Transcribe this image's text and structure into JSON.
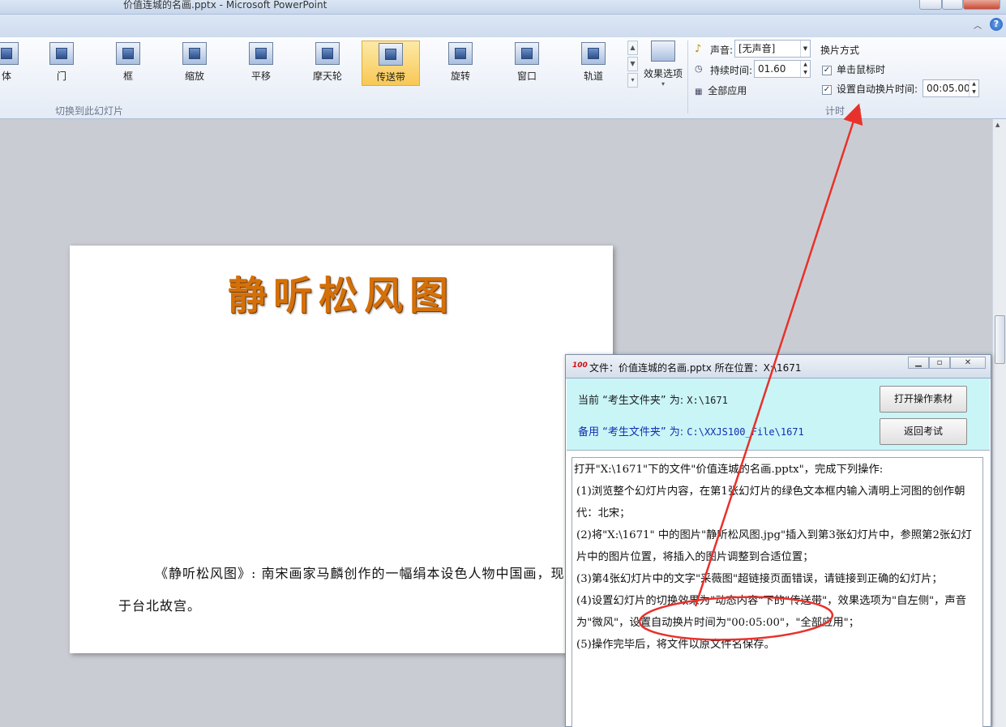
{
  "window": {
    "title": "价值连城的名画.pptx  -  Microsoft PowerPoint"
  },
  "ribbon": {
    "transitions": [
      {
        "label": "体"
      },
      {
        "label": "门"
      },
      {
        "label": "框"
      },
      {
        "label": "缩放"
      },
      {
        "label": "平移"
      },
      {
        "label": "摩天轮"
      },
      {
        "label": "传送带",
        "selected": true
      },
      {
        "label": "旋转"
      },
      {
        "label": "窗口"
      },
      {
        "label": "轨道"
      }
    ],
    "effect_options_label": "效果选项",
    "gallery_group_label": "切换到此幻灯片",
    "sound_label": "声音:",
    "sound_value": "[无声音]",
    "duration_label": "持续时间:",
    "duration_value": "01.60",
    "apply_all_label": "全部应用",
    "advance_title": "换片方式",
    "on_click_label": "单击鼠标时",
    "on_click_checked": true,
    "auto_advance_label": "设置自动换片时间:",
    "auto_advance_checked": true,
    "auto_advance_value": "00:05.00",
    "timing_group_label": "计时"
  },
  "slide": {
    "title": "静听松风图",
    "caption": "《静听松风图》: 南宋画家马麟创作的一幅绢本设色人物中国画，现藏于台北故宫。"
  },
  "dialog": {
    "title": "文件：价值连城的名画.pptx 所在位置：X:\\1671",
    "current_folder_label": "当前 “考生文件夹” 为:",
    "current_folder_value": "X:\\1671",
    "backup_folder_label": "备用 “考生文件夹” 为:",
    "backup_folder_value": "C:\\XXJS100_File\\1671",
    "open_button": "打开操作素材",
    "return_button": "返回考试",
    "instructions": [
      "打开\"X:\\1671\"下的文件\"价值连城的名画.pptx\"，完成下列操作:",
      "(1)浏览整个幻灯片内容，在第1张幻灯片的绿色文本框内输入清明上河图的创作朝代：北宋；",
      "(2)将\"X:\\1671\" 中的图片\"静听松风图.jpg\"插入到第3张幻灯片中，参照第2张幻灯片中的图片位置，将插入的图片调整到合适位置；",
      "(3)第4张幻灯片中的文字\"采薇图\"超链接页面错误，请链接到正确的幻灯片；",
      "(4)设置幻灯片的切换效果为\"动态内容\"下的\"传送带\"，效果选项为\"自左侧\"，声音为\"微风\"，设置自动换片时间为\"00:05:00\"，\"全部应用\"；",
      "(5)操作完毕后，将文件以原文件名保存。"
    ]
  },
  "colors": {
    "ribbon_bg": "#e4ebf5",
    "selected_item": "#f8c855",
    "slide_title": "#d4700a",
    "dialog_info_bg": "#c9f5f7",
    "annotation": "#e8312b",
    "backup_path": "#1030b0"
  }
}
